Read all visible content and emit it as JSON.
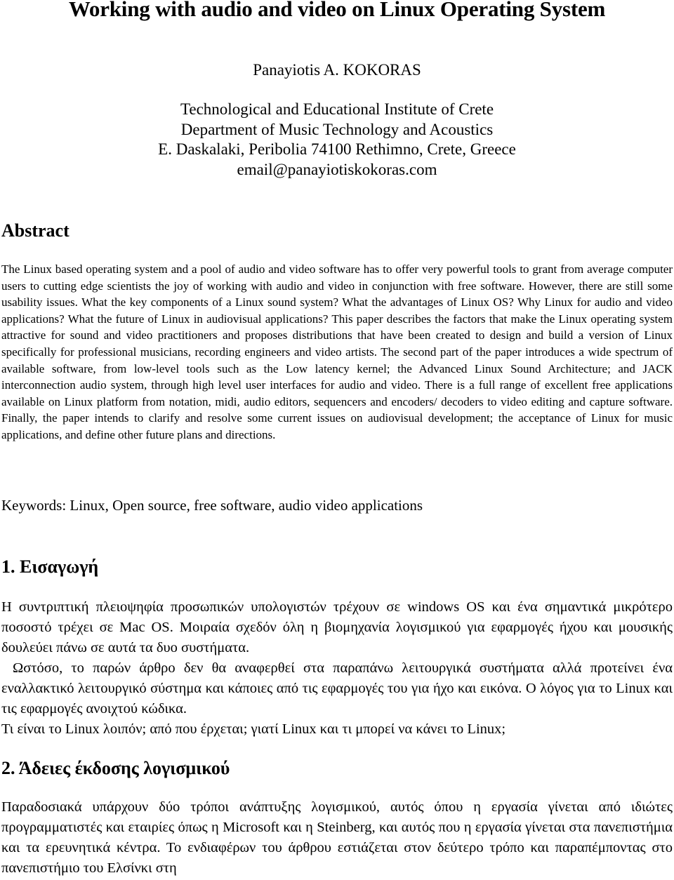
{
  "title": "Working with audio and video on Linux Operating System",
  "author": {
    "name": "Panayiotis A. KOKORAS",
    "affiliation_lines": [
      "Technological and Educational Institute of Crete",
      "Department of Music Technology and Acoustics",
      "E. Daskalaki, Peribolia 74100 Rethimno, Crete, Greece",
      "email@panayiotiskokoras.com"
    ]
  },
  "abstract": {
    "heading": "Abstract",
    "text": "The Linux based operating system and a pool of audio and video software has to offer very powerful tools to grant from average computer users to cutting edge scientists the joy of working with audio and video in conjunction with free software. However, there are still some usability issues. What the key components of a Linux sound system? What the advantages of Linux OS? Why Linux for audio and video applications? What the future of Linux in audiovisual applications? This paper describes the factors that make the Linux operating system attractive for sound and video practitioners and proposes distributions that have been created to design and build a version of Linux specifically for professional musicians, recording engineers and video artists. The second part of the paper introduces a wide spectrum of available software, from low-level tools such as the Low latency kernel; the Advanced Linux Sound Architecture; and JACK interconnection audio system, through high level user interfaces for audio and video. There is a full range of excellent free applications available on Linux platform from notation, midi, audio editors, sequencers and encoders/ decoders to video editing and capture software. Finally, the paper intends to clarify and resolve some current issues on audiovisual development; the acceptance of Linux for music applications, and define other future plans and directions."
  },
  "keywords": "Keywords: Linux, Open source, free software, audio video applications",
  "sections": [
    {
      "heading": "1. Εισαγωγή",
      "paragraphs": [
        "Η συντριπτική πλειοψηφία προσωπικών υπολογιστών τρέχουν σε windows OS και ένα σημαντικά μικρότερο ποσοστό τρέχει σε Mac OS. Μοιραία σχεδόν όλη η βιομηχανία λογισμικού για εφαρμογές ήχου και μουσικής δουλεύει πάνω σε αυτά τα δυο συστήματα.",
        "Ωστόσο, το παρών άρθρο δεν θα αναφερθεί στα παραπάνω λειτουργικά συστήματα  αλλά προτείνει ένα εναλλακτικό λειτουργικό σύστημα και κάποιες από τις εφαρμογές του για ήχο και εικόνα. Ο λόγος για το Linux και τις εφαρμογές ανοιχτού κώδικα.",
        "Τι είναι το Linux λοιπόν; από που έρχεται; γιατί Linux και τι μπορεί να κάνει το Linux;"
      ]
    },
    {
      "heading": "2. Άδειες έκδοσης λογισμικού",
      "paragraphs": [
        "Παραδοσιακά υπάρχουν δύο τρόποι ανάπτυξης λογισμικού, αυτός όπου η εργασία γίνεται από ιδιώτες προγραμματιστές και εταιρίες όπως η Microsoft και η Steinberg, και αυτός που η εργασία γίνεται στα πανεπιστήμια και τα ερευνητικά κέντρα. Το ενδιαφέρων του άρθρου εστιάζεται στον δεύτερο τρόπο και παραπέμποντας στο πανεπιστήμιο του Ελσίνκι στη"
      ]
    }
  ]
}
